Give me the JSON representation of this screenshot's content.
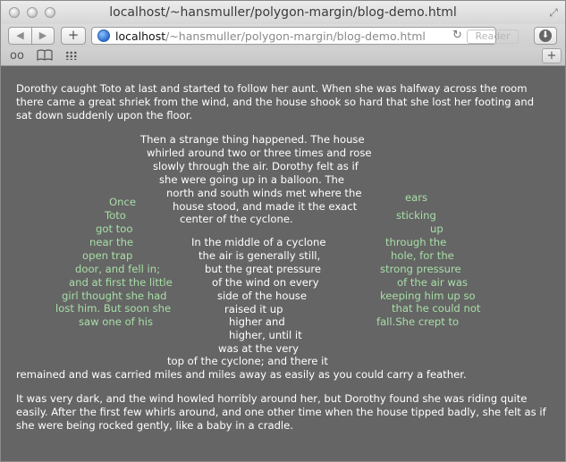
{
  "window": {
    "title": "localhost/~hansmuller/polygon-margin/blog-demo.html"
  },
  "toolbar": {
    "back": "◀",
    "forward": "▶",
    "add": "+",
    "url_host": "localhost",
    "url_path": "/~hansmuller/polygon-margin/blog-demo.html",
    "reader": "Reader",
    "reload": "↻",
    "download": "⬇"
  },
  "bookmarks": {
    "glasses": "oo",
    "book": "📖",
    "newtab": "+"
  },
  "content": {
    "p1": "Dorothy caught Toto at last and started to follow her aunt. When she was halfway across the room there came a great shriek from the wind, and the house shook so hard that she lost her footing and sat down suddenly upon the floor.",
    "center_lines": [
      "Then  a  strange  thing  happened.  The  house",
      "whirled  around  two  or  three  times  and  rose",
      "slowly  through  the  air.  Dorothy  felt  as  if",
      "she  were  going  up  in  a  balloon.  The",
      "north and south winds met where the",
      "house stood, and made it the exact",
      "center of the cyclone.",
      "In  the  middle  of  a  cyclone",
      "the  air  is  generally  still,",
      "but  the  great  pressure",
      "of the wind on every",
      "side  of  the  house",
      "raised      it      up",
      "higher         and",
      "higher,  until  it",
      "was   at   the   very",
      "top   of   the   cyclone;   and   there   it"
    ],
    "p_end": "remained and was carried miles and miles away as easily as you could carry a feather.",
    "left_lines": [
      "Once",
      "Toto",
      "got too",
      "near the",
      "open trap",
      "door, and fell in;",
      "and at first the little",
      "girl thought she had",
      "lost him. But soon she",
      "saw one of his"
    ],
    "right_lines": [
      "ears",
      "sticking",
      "up",
      "through the",
      "hole, for the",
      "strong pressure",
      "of the air was",
      "keeping him up so",
      "that he could not",
      "fall.She crept to"
    ],
    "p_last": "It was very dark, and the wind howled horribly around her, but Dorothy found she was riding quite easily. After the first few whirls around, and one other time when the house tipped badly, she felt as if she were being rocked gently, like a baby in a cradle."
  }
}
